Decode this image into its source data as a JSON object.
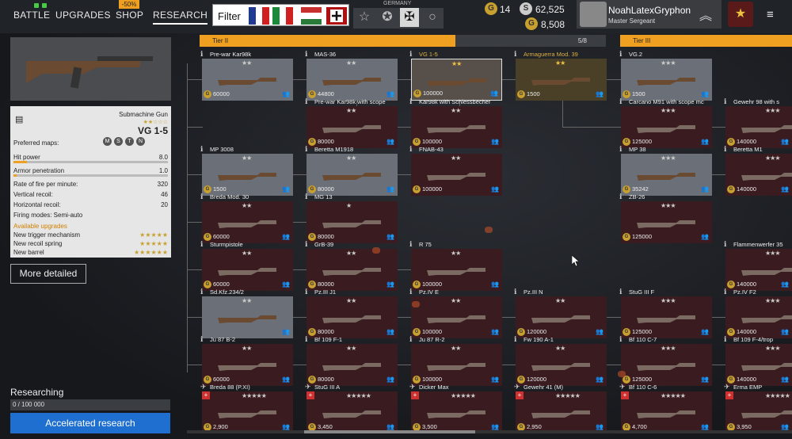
{
  "nav": {
    "battle": "BATTLE",
    "upgrades": "UPGRADES",
    "shop": "SHOP",
    "shop_badge": "-50%",
    "research": "RESEARCH"
  },
  "filter": {
    "label": "Filter"
  },
  "nation": {
    "label": "GERMANY"
  },
  "currency": {
    "eagles": "14",
    "silver": "62,525",
    "gold": "8,508"
  },
  "profile": {
    "name": "NoahLatexGryphon",
    "rank": "Master Sergeant"
  },
  "weapon": {
    "type": "Submachine Gun",
    "name": "VG 1-5",
    "maps_label": "Preferred maps:",
    "maps": [
      "M",
      "S",
      "T",
      "N"
    ],
    "stats": [
      {
        "label": "Hit power",
        "value": "8.0"
      },
      {
        "label": "Armor penetration",
        "value": "1.0"
      },
      {
        "label": "Rate of fire per minute:",
        "value": "320"
      },
      {
        "label": "Vertical recoil:",
        "value": "46"
      },
      {
        "label": "Horizontal recoil:",
        "value": "20"
      },
      {
        "label": "Firing modes: Semi-auto",
        "value": ""
      }
    ],
    "hit_power_fraction": 0.08,
    "armor_pen_fraction": 0.02,
    "upgrades_label": "Available upgrades",
    "upgrades": [
      {
        "label": "New trigger mechanism",
        "stars": "★★★★★"
      },
      {
        "label": "New recoil spring",
        "stars": "★★★★★"
      },
      {
        "label": "New barrel",
        "stars": "★★★★★★"
      }
    ]
  },
  "buttons": {
    "more": "More detailed",
    "accelerated": "Accelerated research"
  },
  "research": {
    "label": "Researching",
    "progress": "0 / 100 000"
  },
  "tiers": {
    "tier2": "Tier II",
    "tier2_count": "5/8",
    "tier3": "Tier III"
  },
  "cards": [
    {
      "name": "Pre-war Kar98k",
      "stars": "★★",
      "price": "60000",
      "state": "done"
    },
    {
      "name": "MAS-36",
      "stars": "★★",
      "price": "44800",
      "state": "done"
    },
    {
      "name": "VG 1-5",
      "stars": "★★",
      "price": "100000",
      "state": "sel",
      "gold": true
    },
    {
      "name": "Armaguerra Mod. 39",
      "stars": "★★",
      "price": "1500",
      "state": "gold",
      "gold": true
    },
    {
      "name": "VG.2",
      "stars": "★★★",
      "price": "1500",
      "state": "done"
    },
    {
      "name": "Pre-war Kar98k with scope",
      "stars": "★★",
      "price": "80000",
      "state": "locked"
    },
    {
      "name": "Kar98k with Schiessbecher",
      "stars": "★★",
      "price": "100000",
      "state": "locked"
    },
    {
      "name": "Carcano M91 with scope mc",
      "stars": "★★★",
      "price": "125000",
      "state": "locked"
    },
    {
      "name": "Gewehr 98 with s",
      "stars": "★★★",
      "price": "140000",
      "state": "locked"
    },
    {
      "name": "MP 3008",
      "stars": "★★",
      "price": "1500",
      "state": "done"
    },
    {
      "name": "Beretta M1918",
      "stars": "★★",
      "price": "80000",
      "state": "done"
    },
    {
      "name": "FNAB-43",
      "stars": "★★",
      "price": "100000",
      "state": "locked"
    },
    {
      "name": "MP 38",
      "stars": "★★★",
      "price": "35242",
      "state": "done"
    },
    {
      "name": "Beretta M1",
      "stars": "★★★",
      "price": "140000",
      "state": "locked"
    },
    {
      "name": "Breda Mod. 30",
      "stars": "★★",
      "price": "60000",
      "state": "locked"
    },
    {
      "name": "MG 13",
      "stars": "★",
      "price": "80000",
      "state": "locked"
    },
    {
      "name": "ZB-26",
      "stars": "★★★",
      "price": "125000",
      "state": "locked"
    },
    {
      "name": "Sturmpistole",
      "stars": "★★",
      "price": "60000",
      "state": "locked"
    },
    {
      "name": "GrB-39",
      "stars": "★★",
      "price": "80000",
      "state": "locked"
    },
    {
      "name": "R 75",
      "stars": "★★",
      "price": "100000",
      "state": "locked"
    },
    {
      "name": "Flammenwerfer 35",
      "stars": "★★★",
      "price": "140000",
      "state": "locked"
    },
    {
      "name": "Sd.Kfz.234/2",
      "stars": "★★",
      "price": "",
      "state": "done"
    },
    {
      "name": "Pz.III J1",
      "stars": "★★",
      "price": "80000",
      "state": "locked"
    },
    {
      "name": "Pz.IV E",
      "stars": "★★",
      "price": "100000",
      "state": "locked"
    },
    {
      "name": "Pz.III N",
      "stars": "★★",
      "price": "120000",
      "state": "locked"
    },
    {
      "name": "StuG III F",
      "stars": "★★★",
      "price": "125000",
      "state": "locked"
    },
    {
      "name": "Pz.IV F2",
      "stars": "★★★",
      "price": "140000",
      "state": "locked"
    },
    {
      "name": "Ju 87 B-2",
      "stars": "★★",
      "price": "60000",
      "state": "locked"
    },
    {
      "name": "Bf 109 F-1",
      "stars": "★★",
      "price": "80000",
      "state": "locked"
    },
    {
      "name": "Ju 87 R-2",
      "stars": "★★",
      "price": "100000",
      "state": "locked"
    },
    {
      "name": "Fw 190 A-1",
      "stars": "★★",
      "price": "120000",
      "state": "locked"
    },
    {
      "name": "Bf 110 C-7",
      "stars": "★★★",
      "price": "125000",
      "state": "locked"
    },
    {
      "name": "Bf 109 F-4/trop",
      "stars": "★★★",
      "price": "140000",
      "state": "locked"
    },
    {
      "name": "Breda 88 (P.XI)",
      "stars": "★★★★★",
      "price": "2,900",
      "state": "premium"
    },
    {
      "name": "StuG III A",
      "stars": "★★★★★",
      "price": "3,450",
      "state": "premium"
    },
    {
      "name": "Dicker Max",
      "stars": "★★★★★",
      "price": "3,500",
      "state": "premium"
    },
    {
      "name": "Gewehr 41 (M)",
      "stars": "★★★★★",
      "price": "2,950",
      "state": "premium"
    },
    {
      "name": "Bf 110 C-6",
      "stars": "★★★★★",
      "price": "4,700",
      "state": "premium"
    },
    {
      "name": "Erma EMP",
      "stars": "★★★★★",
      "price": "3,950",
      "state": "premium"
    }
  ],
  "colors": {
    "accent": "#f0a020",
    "locked": "#3a1c20",
    "researched": "#6b7078",
    "blue": "#1e6fd0"
  }
}
